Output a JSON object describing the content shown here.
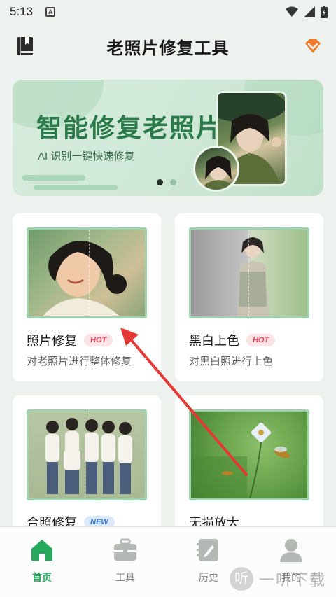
{
  "status_bar": {
    "time": "5:13",
    "notification_icon": "A"
  },
  "header": {
    "title": "老照片修复工具",
    "left_icon": "book-icon",
    "right_icon": "vip-diamond-icon"
  },
  "banner": {
    "headline": "智能修复老照片",
    "subtitle": "AI 识别一键快速修复",
    "page_count": 2,
    "active_page": 1
  },
  "features": [
    {
      "name": "照片修复",
      "badge": "HOT",
      "badge_type": "hot",
      "description": "对老照片进行整体修复"
    },
    {
      "name": "黑白上色",
      "badge": "HOT",
      "badge_type": "hot",
      "description": "对黑白照进行上色"
    },
    {
      "name": "合照修复",
      "badge": "NEW",
      "badge_type": "new",
      "description": ""
    },
    {
      "name": "无损放大",
      "badge": "",
      "badge_type": "",
      "description": ""
    }
  ],
  "bottom_nav": [
    {
      "label": "首页",
      "icon": "home-icon",
      "active": true
    },
    {
      "label": "工具",
      "icon": "toolbox-icon",
      "active": false
    },
    {
      "label": "历史",
      "icon": "history-icon",
      "active": false
    },
    {
      "label": "我的",
      "icon": "profile-icon",
      "active": false
    }
  ],
  "watermark": {
    "logo": "听",
    "text": "一听下载"
  },
  "colors": {
    "accent_green": "#27a85c",
    "banner_headline": "#2a7a4a",
    "hot_badge": "#e24a60",
    "new_badge": "#3a7bd5",
    "vip_orange": "#f07a2a",
    "arrow_red": "#e53935"
  }
}
